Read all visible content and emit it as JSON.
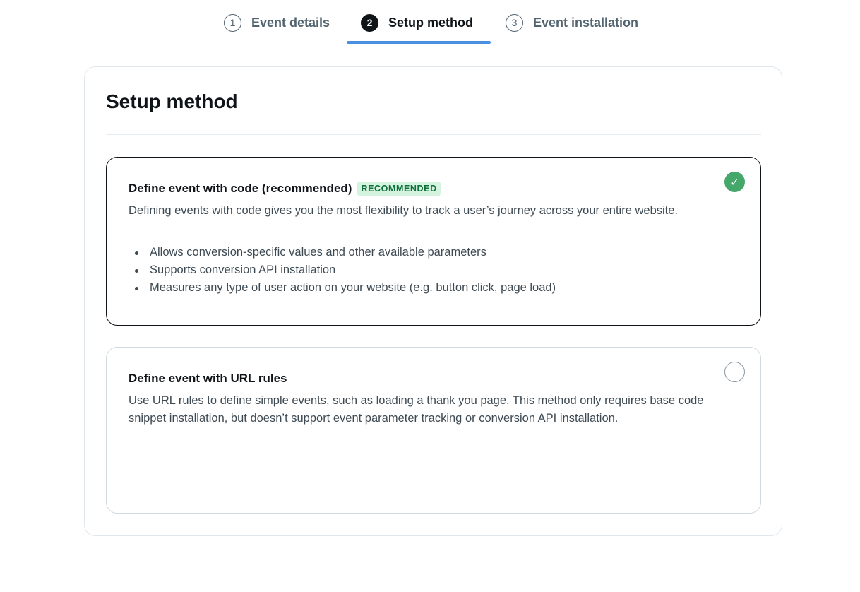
{
  "stepper": {
    "steps": [
      {
        "number": "1",
        "label": "Event details",
        "state": "inactive"
      },
      {
        "number": "2",
        "label": "Setup method",
        "state": "active"
      },
      {
        "number": "3",
        "label": "Event installation",
        "state": "inactive"
      }
    ],
    "active_color": "#4a90e2"
  },
  "panel": {
    "title": "Setup method",
    "options": [
      {
        "title": "Define event with code (recommended)",
        "badge": "RECOMMENDED",
        "description": "Defining events with code gives you the most flexibility to track a user’s journey across your entire website.",
        "bullets": [
          "Allows conversion-specific values and other available parameters",
          "Supports conversion API installation",
          "Measures any type of user action on your website (e.g. button click, page load)"
        ],
        "selected": true,
        "check_icon": "checkmark-icon"
      },
      {
        "title": "Define event with URL rules",
        "description": "Use URL rules to define simple events, such as loading a thank you page. This method only requires base code snippet installation, but doesn’t support event parameter tracking or conversion API installation.",
        "selected": false
      }
    ]
  },
  "colors": {
    "selected_check": "#45a86b",
    "badge_bg": "#d4f4df",
    "badge_text": "#0d6e3a"
  }
}
